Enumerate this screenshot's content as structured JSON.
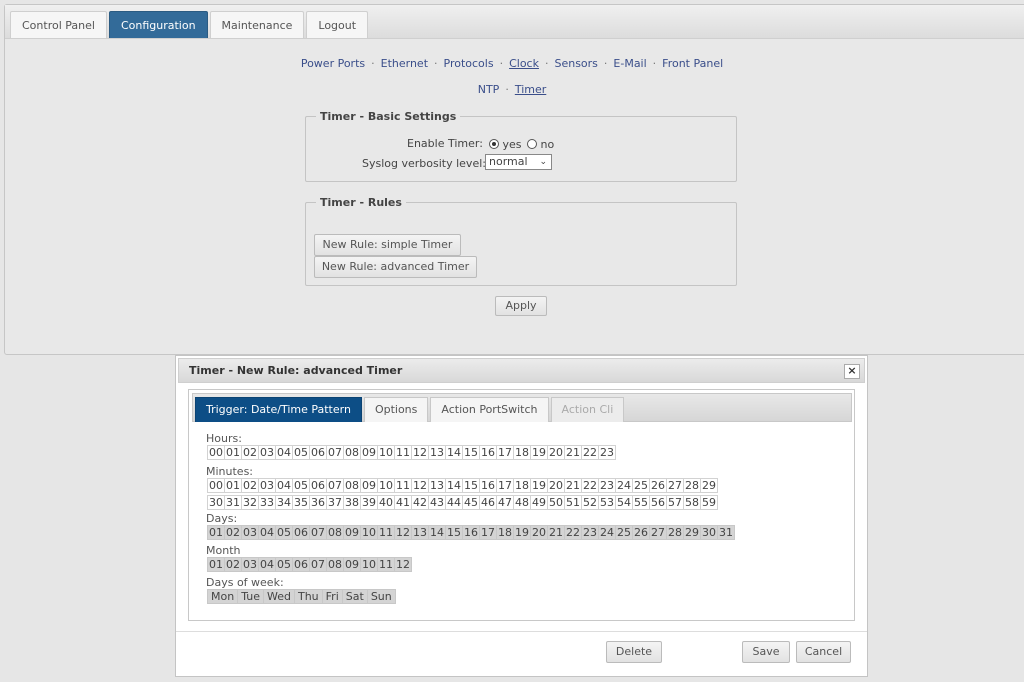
{
  "main_tabs": [
    {
      "label": "Control Panel",
      "active": false
    },
    {
      "label": "Configuration",
      "active": true
    },
    {
      "label": "Maintenance",
      "active": false
    },
    {
      "label": "Logout",
      "active": false
    }
  ],
  "subnav1": [
    "Power Ports",
    "Ethernet",
    "Protocols",
    "Clock",
    "Sensors",
    "E-Mail",
    "Front Panel"
  ],
  "subnav1_current": "Clock",
  "subnav2": [
    "NTP",
    "Timer"
  ],
  "subnav2_current": "Timer",
  "basic": {
    "legend": "Timer - Basic Settings",
    "enable_label": "Enable Timer:",
    "yes_label": "yes",
    "no_label": "no",
    "enable_value": "yes",
    "syslog_label": "Syslog verbosity level:",
    "syslog_value": "normal"
  },
  "rules": {
    "legend": "Timer - Rules",
    "simple_button": "New Rule: simple Timer",
    "advanced_button": "New Rule: advanced Timer"
  },
  "apply_button": "Apply",
  "dialog": {
    "title": "Timer - New Rule: advanced Timer",
    "close_symbol": "×",
    "tabs": [
      {
        "label": "Trigger: Date/Time Pattern",
        "state": "active"
      },
      {
        "label": "Options",
        "state": "normal"
      },
      {
        "label": "Action PortSwitch",
        "state": "normal"
      },
      {
        "label": "Action Cli",
        "state": "disabled"
      }
    ],
    "hours_label": "Hours:",
    "minutes_label": "Minutes:",
    "days_label": "Days:",
    "month_label": "Month",
    "dow_label": "Days of week:",
    "days_of_week": [
      "Mon",
      "Tue",
      "Wed",
      "Thu",
      "Fri",
      "Sat",
      "Sun"
    ],
    "delete_button": "Delete",
    "save_button": "Save",
    "cancel_button": "Cancel"
  },
  "colors": {
    "active_tab": "#336b99",
    "dialog_active_tab": "#0d4e86",
    "link": "#3a4e8a"
  }
}
